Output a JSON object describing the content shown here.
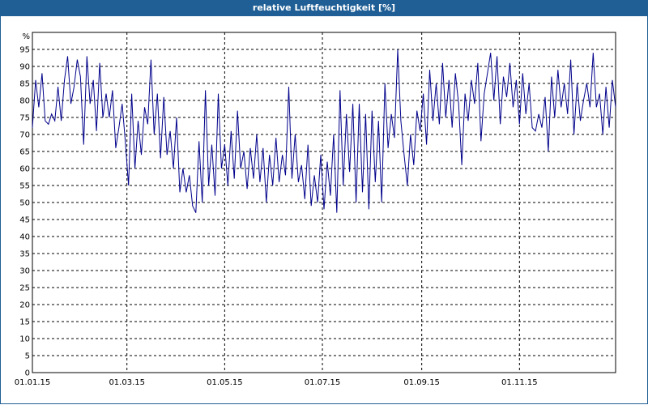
{
  "window": {
    "title": "relative Luftfeuchtigkeit [%]"
  },
  "colors": {
    "titlebar": "#1f5f95",
    "series": "#00008b",
    "grid": "#000000",
    "background": "#ffffff"
  },
  "chart_data": {
    "type": "line",
    "title": "relative Luftfeuchtigkeit [%]",
    "ylabel": "%",
    "xlabel": "",
    "ylim": [
      0,
      100
    ],
    "yticks": [
      0,
      5,
      10,
      15,
      20,
      25,
      30,
      35,
      40,
      45,
      50,
      55,
      60,
      65,
      70,
      75,
      80,
      85,
      90,
      95
    ],
    "xlim": [
      "2015-01-01",
      "2015-12-31"
    ],
    "xticks": [
      {
        "date": "2015-01-01",
        "label": "01.01.15"
      },
      {
        "date": "2015-03-01",
        "label": "01.03.15"
      },
      {
        "date": "2015-05-01",
        "label": "01.05.15"
      },
      {
        "date": "2015-07-01",
        "label": "01.07.15"
      },
      {
        "date": "2015-09-01",
        "label": "01.09.15"
      },
      {
        "date": "2015-11-01",
        "label": "01.11.15"
      }
    ],
    "grid": true,
    "grid_style": "dashed",
    "series": [
      {
        "values": [
          [
            "2015-01-01",
            72
          ],
          [
            "2015-01-03",
            86
          ],
          [
            "2015-01-05",
            78
          ],
          [
            "2015-01-07",
            88
          ],
          [
            "2015-01-09",
            74
          ],
          [
            "2015-01-11",
            73
          ],
          [
            "2015-01-13",
            76
          ],
          [
            "2015-01-15",
            74
          ],
          [
            "2015-01-17",
            84
          ],
          [
            "2015-01-19",
            74
          ],
          [
            "2015-01-21",
            86
          ],
          [
            "2015-01-23",
            93
          ],
          [
            "2015-01-25",
            79
          ],
          [
            "2015-01-27",
            84
          ],
          [
            "2015-01-29",
            92
          ],
          [
            "2015-01-31",
            87
          ],
          [
            "2015-02-02",
            67
          ],
          [
            "2015-02-04",
            93
          ],
          [
            "2015-02-06",
            79
          ],
          [
            "2015-02-08",
            86
          ],
          [
            "2015-02-10",
            71
          ],
          [
            "2015-02-12",
            91
          ],
          [
            "2015-02-14",
            75
          ],
          [
            "2015-02-16",
            82
          ],
          [
            "2015-02-18",
            75
          ],
          [
            "2015-02-20",
            83
          ],
          [
            "2015-02-22",
            66
          ],
          [
            "2015-02-24",
            72
          ],
          [
            "2015-02-26",
            79
          ],
          [
            "2015-02-28",
            68
          ],
          [
            "2015-03-02",
            55
          ],
          [
            "2015-03-04",
            82
          ],
          [
            "2015-03-06",
            60
          ],
          [
            "2015-03-08",
            74
          ],
          [
            "2015-03-10",
            64
          ],
          [
            "2015-03-12",
            78
          ],
          [
            "2015-03-14",
            73
          ],
          [
            "2015-03-16",
            92
          ],
          [
            "2015-03-18",
            70
          ],
          [
            "2015-03-20",
            82
          ],
          [
            "2015-03-22",
            63
          ],
          [
            "2015-03-24",
            81
          ],
          [
            "2015-03-26",
            64
          ],
          [
            "2015-03-28",
            71
          ],
          [
            "2015-03-30",
            60
          ],
          [
            "2015-04-01",
            75
          ],
          [
            "2015-04-03",
            53
          ],
          [
            "2015-04-05",
            60
          ],
          [
            "2015-04-07",
            53
          ],
          [
            "2015-04-09",
            58
          ],
          [
            "2015-04-11",
            49
          ],
          [
            "2015-04-13",
            47
          ],
          [
            "2015-04-15",
            68
          ],
          [
            "2015-04-17",
            50
          ],
          [
            "2015-04-19",
            83
          ],
          [
            "2015-04-21",
            55
          ],
          [
            "2015-04-23",
            67
          ],
          [
            "2015-04-25",
            52
          ],
          [
            "2015-04-27",
            82
          ],
          [
            "2015-04-29",
            60
          ],
          [
            "2015-05-01",
            67
          ],
          [
            "2015-05-03",
            55
          ],
          [
            "2015-05-05",
            71
          ],
          [
            "2015-05-07",
            57
          ],
          [
            "2015-05-09",
            77
          ],
          [
            "2015-05-11",
            60
          ],
          [
            "2015-05-13",
            65
          ],
          [
            "2015-05-15",
            54
          ],
          [
            "2015-05-17",
            66
          ],
          [
            "2015-05-19",
            57
          ],
          [
            "2015-05-21",
            70
          ],
          [
            "2015-05-23",
            56
          ],
          [
            "2015-05-25",
            66
          ],
          [
            "2015-05-27",
            50
          ],
          [
            "2015-05-29",
            64
          ],
          [
            "2015-05-31",
            55
          ],
          [
            "2015-06-02",
            69
          ],
          [
            "2015-06-04",
            56
          ],
          [
            "2015-06-06",
            64
          ],
          [
            "2015-06-08",
            58
          ],
          [
            "2015-06-10",
            84
          ],
          [
            "2015-06-12",
            57
          ],
          [
            "2015-06-14",
            70
          ],
          [
            "2015-06-16",
            56
          ],
          [
            "2015-06-18",
            61
          ],
          [
            "2015-06-20",
            51
          ],
          [
            "2015-06-22",
            67
          ],
          [
            "2015-06-24",
            49
          ],
          [
            "2015-06-26",
            58
          ],
          [
            "2015-06-28",
            50
          ],
          [
            "2015-06-30",
            64
          ],
          [
            "2015-07-02",
            48
          ],
          [
            "2015-07-04",
            62
          ],
          [
            "2015-07-06",
            52
          ],
          [
            "2015-07-08",
            70
          ],
          [
            "2015-07-10",
            47
          ],
          [
            "2015-07-12",
            83
          ],
          [
            "2015-07-14",
            55
          ],
          [
            "2015-07-16",
            76
          ],
          [
            "2015-07-18",
            59
          ],
          [
            "2015-07-20",
            79
          ],
          [
            "2015-07-22",
            50
          ],
          [
            "2015-07-24",
            79
          ],
          [
            "2015-07-26",
            53
          ],
          [
            "2015-07-28",
            76
          ],
          [
            "2015-07-30",
            48
          ],
          [
            "2015-08-01",
            77
          ],
          [
            "2015-08-03",
            56
          ],
          [
            "2015-08-05",
            74
          ],
          [
            "2015-08-07",
            50
          ],
          [
            "2015-08-09",
            85
          ],
          [
            "2015-08-11",
            66
          ],
          [
            "2015-08-13",
            76
          ],
          [
            "2015-08-15",
            69
          ],
          [
            "2015-08-17",
            95
          ],
          [
            "2015-08-19",
            74
          ],
          [
            "2015-08-21",
            64
          ],
          [
            "2015-08-23",
            55
          ],
          [
            "2015-08-25",
            70
          ],
          [
            "2015-08-27",
            61
          ],
          [
            "2015-08-29",
            77
          ],
          [
            "2015-08-31",
            71
          ],
          [
            "2015-09-02",
            82
          ],
          [
            "2015-09-04",
            67
          ],
          [
            "2015-09-06",
            89
          ],
          [
            "2015-09-08",
            74
          ],
          [
            "2015-09-10",
            85
          ],
          [
            "2015-09-12",
            73
          ],
          [
            "2015-09-14",
            91
          ],
          [
            "2015-09-16",
            75
          ],
          [
            "2015-09-18",
            86
          ],
          [
            "2015-09-20",
            72
          ],
          [
            "2015-09-22",
            88
          ],
          [
            "2015-09-24",
            79
          ],
          [
            "2015-09-26",
            61
          ],
          [
            "2015-09-28",
            82
          ],
          [
            "2015-09-30",
            74
          ],
          [
            "2015-10-02",
            86
          ],
          [
            "2015-10-04",
            79
          ],
          [
            "2015-10-06",
            91
          ],
          [
            "2015-10-08",
            68
          ],
          [
            "2015-10-10",
            82
          ],
          [
            "2015-10-12",
            88
          ],
          [
            "2015-10-14",
            94
          ],
          [
            "2015-10-16",
            80
          ],
          [
            "2015-10-18",
            93
          ],
          [
            "2015-10-20",
            73
          ],
          [
            "2015-10-22",
            87
          ],
          [
            "2015-10-24",
            81
          ],
          [
            "2015-10-26",
            91
          ],
          [
            "2015-10-28",
            78
          ],
          [
            "2015-10-30",
            86
          ],
          [
            "2015-11-01",
            73
          ],
          [
            "2015-11-03",
            88
          ],
          [
            "2015-11-05",
            76
          ],
          [
            "2015-11-07",
            85
          ],
          [
            "2015-11-09",
            72
          ],
          [
            "2015-11-11",
            71
          ],
          [
            "2015-11-13",
            76
          ],
          [
            "2015-11-15",
            72
          ],
          [
            "2015-11-17",
            81
          ],
          [
            "2015-11-19",
            65
          ],
          [
            "2015-11-21",
            87
          ],
          [
            "2015-11-23",
            75
          ],
          [
            "2015-11-25",
            89
          ],
          [
            "2015-11-27",
            78
          ],
          [
            "2015-11-29",
            85
          ],
          [
            "2015-12-01",
            76
          ],
          [
            "2015-12-03",
            92
          ],
          [
            "2015-12-05",
            70
          ],
          [
            "2015-12-07",
            85
          ],
          [
            "2015-12-09",
            74
          ],
          [
            "2015-12-11",
            80
          ],
          [
            "2015-12-13",
            85
          ],
          [
            "2015-12-15",
            78
          ],
          [
            "2015-12-17",
            94
          ],
          [
            "2015-12-19",
            78
          ],
          [
            "2015-12-21",
            82
          ],
          [
            "2015-12-23",
            70
          ],
          [
            "2015-12-25",
            84
          ],
          [
            "2015-12-27",
            72
          ],
          [
            "2015-12-29",
            86
          ],
          [
            "2015-12-31",
            78
          ]
        ]
      }
    ]
  }
}
